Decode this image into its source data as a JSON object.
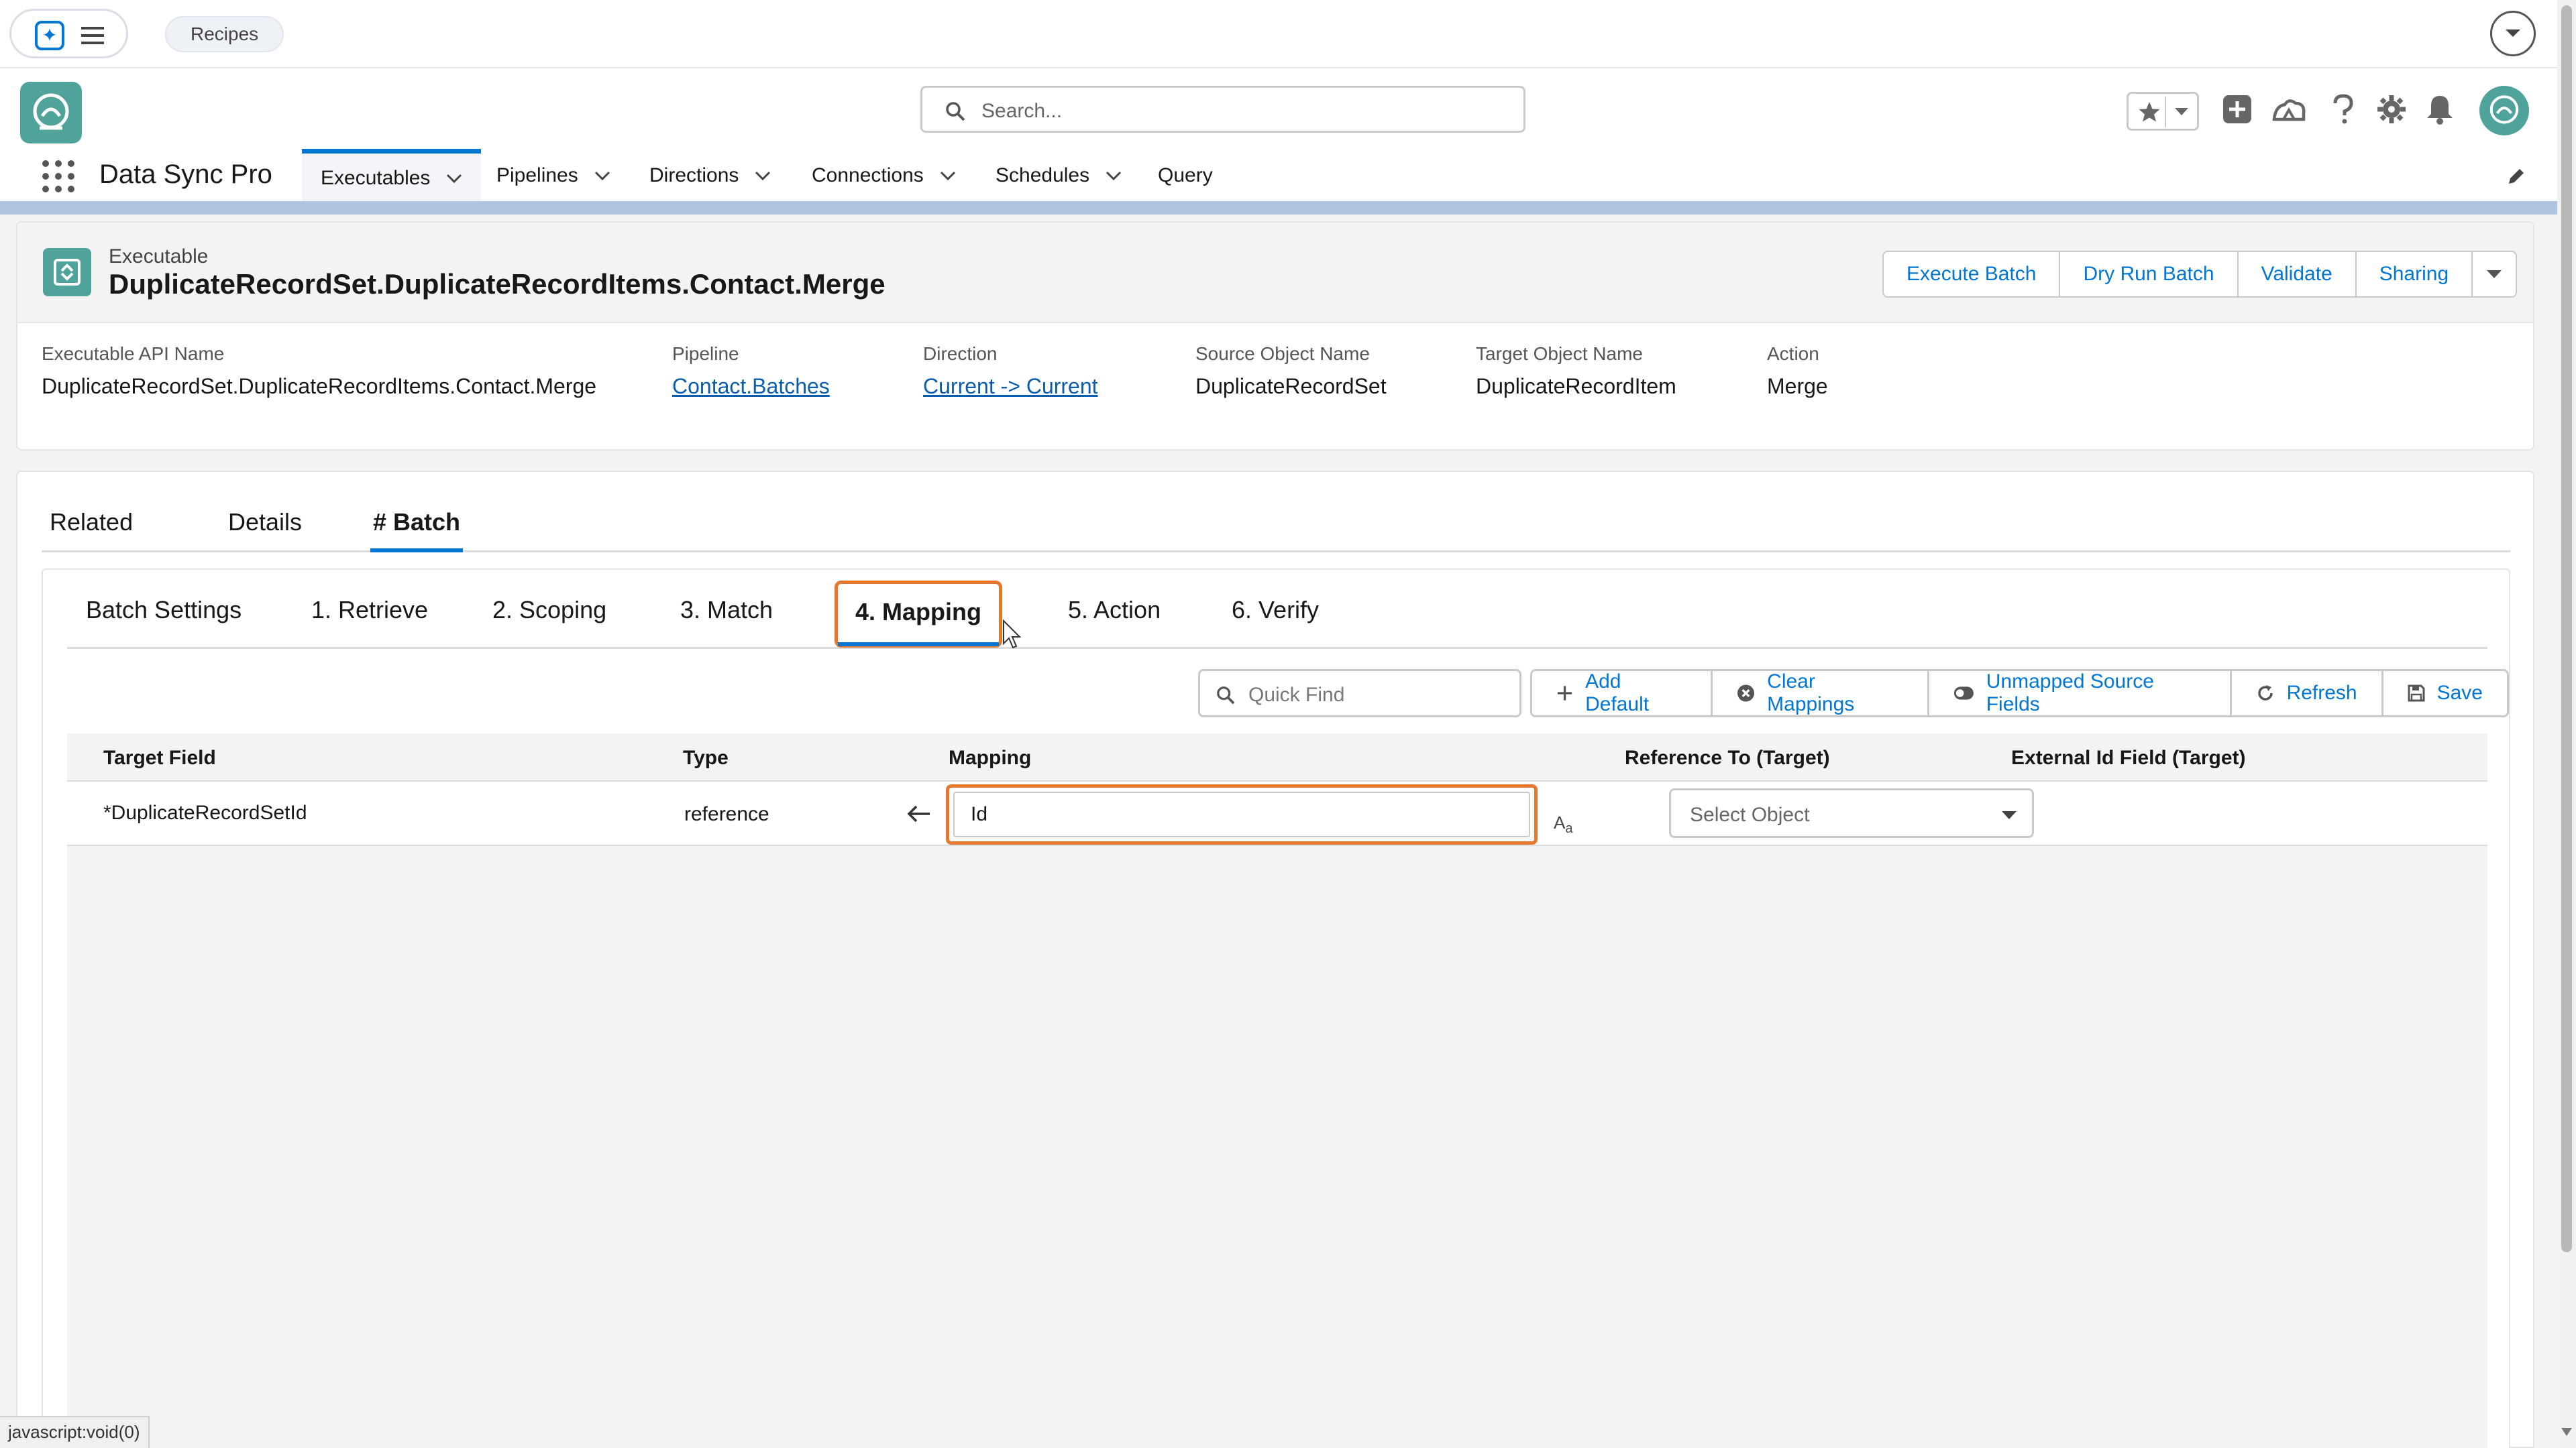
{
  "topbar": {
    "recipes_label": "Recipes"
  },
  "header": {
    "search_placeholder": "Search...",
    "app_name": "Data Sync Pro",
    "nav": [
      {
        "label": "Executables",
        "has_menu": true,
        "active": true
      },
      {
        "label": "Pipelines",
        "has_menu": true
      },
      {
        "label": "Directions",
        "has_menu": true
      },
      {
        "label": "Connections",
        "has_menu": true
      },
      {
        "label": "Schedules",
        "has_menu": true
      },
      {
        "label": "Query",
        "has_menu": false
      }
    ]
  },
  "record": {
    "type_label": "Executable",
    "title": "DuplicateRecordSet.DuplicateRecordItems.Contact.Merge",
    "actions": [
      "Execute Batch",
      "Dry Run Batch",
      "Validate",
      "Sharing"
    ],
    "fields": [
      {
        "label": "Executable API Name",
        "value": "DuplicateRecordSet.DuplicateRecordItems.Contact.Merge",
        "link": false
      },
      {
        "label": "Pipeline",
        "value": "Contact.Batches",
        "link": true
      },
      {
        "label": "Direction",
        "value": "Current -> Current",
        "link": true
      },
      {
        "label": "Source Object Name",
        "value": "DuplicateRecordSet",
        "link": false
      },
      {
        "label": "Target Object Name",
        "value": "DuplicateRecordItem",
        "link": false
      },
      {
        "label": "Action",
        "value": "Merge",
        "link": false
      }
    ]
  },
  "tabs": [
    "Related",
    "Details",
    "# Batch"
  ],
  "subtabs": [
    "Batch Settings",
    "1. Retrieve",
    "2. Scoping",
    "3. Match",
    "4. Mapping",
    "5. Action",
    "6. Verify"
  ],
  "toolbar": {
    "quick_find_placeholder": "Quick Find",
    "buttons": [
      "Add Default",
      "Clear Mappings",
      "Unmapped Source Fields",
      "Refresh",
      "Save"
    ]
  },
  "table": {
    "headers": [
      "Target Field",
      "Type",
      "Mapping",
      "Reference To (Target)",
      "External Id Field (Target)"
    ],
    "rows": [
      {
        "target_field": "*DuplicateRecordSetId",
        "type": "reference",
        "mapping": "Id",
        "reference_to_placeholder": "Select Object"
      }
    ]
  },
  "status_bar": "javascript:void(0)",
  "colors": {
    "brand": "#0176d3",
    "highlight": "#e8772e",
    "logo": "#4fa39a"
  },
  "icons": [
    "menu-icon",
    "chevron-down-icon",
    "search-icon",
    "star-icon",
    "plus-icon",
    "cloud-icon",
    "help-icon",
    "gear-icon",
    "bell-icon",
    "pencil-icon",
    "arrow-left-icon"
  ]
}
